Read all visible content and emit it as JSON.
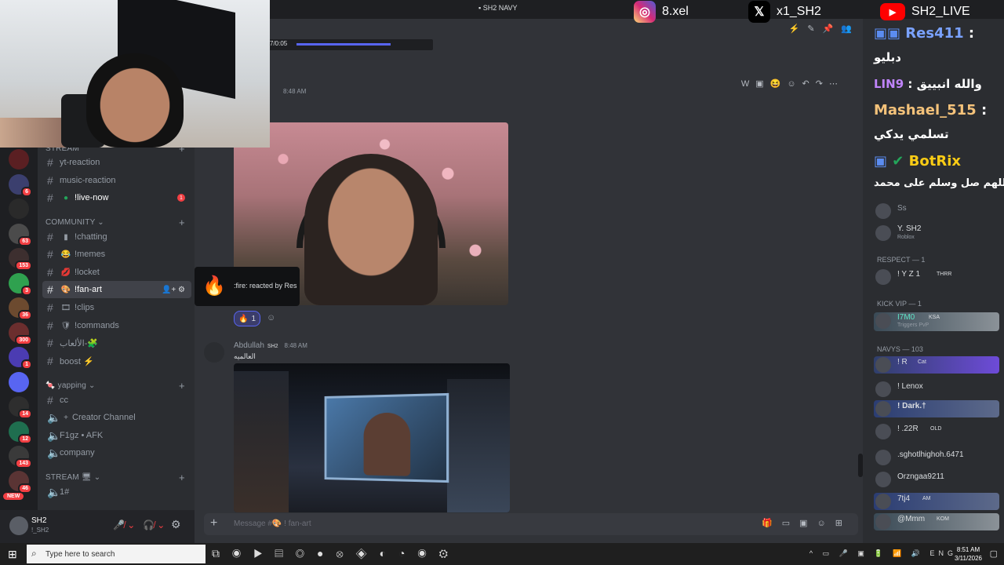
{
  "window": {
    "title": "SH2 NAVY"
  },
  "socials": [
    {
      "platform": "instagram",
      "handle": "8.xel",
      "color": "#d62976"
    },
    {
      "platform": "x",
      "handle": "x1_SH2",
      "color": "#000000"
    },
    {
      "platform": "youtube",
      "handle": "SH2_LIVE",
      "color": "#ff0000"
    }
  ],
  "video": {
    "time": "7/0:05"
  },
  "channels": {
    "categories": {
      "stream": "STREAM",
      "community": "COMMUNITY",
      "yapping": "yapping",
      "stream2": "STREAM"
    },
    "items": [
      {
        "name": "yt-reaction",
        "emoji": ""
      },
      {
        "name": "music-reaction",
        "emoji": ""
      },
      {
        "name": "live-now",
        "emoji": "●",
        "prefix": "!",
        "unread": "1"
      },
      {
        "name": "chatting",
        "emoji": "▮",
        "prefix": "!"
      },
      {
        "name": "memes",
        "emoji": "😂",
        "prefix": "!"
      },
      {
        "name": "locket",
        "emoji": "💋",
        "prefix": "!"
      },
      {
        "name": "fan-art",
        "emoji": "🎨",
        "prefix": "!",
        "active": true
      },
      {
        "name": "clips",
        "emoji": "🎞",
        "prefix": "!"
      },
      {
        "name": "commands",
        "emoji": "🛡",
        "prefix": "!"
      },
      {
        "name": "الألعاب-🧩",
        "emoji": ""
      },
      {
        "name": "boost ⚡",
        "emoji": ""
      },
      {
        "name": "cc",
        "emoji": ""
      },
      {
        "name": "Creator Channel",
        "emoji": "+"
      },
      {
        "name": "F1gz • AFK",
        "emoji": ""
      },
      {
        "name": "company",
        "emoji": ""
      },
      {
        "name": "1#",
        "emoji": ""
      }
    ]
  },
  "servers": [
    {
      "badge": "",
      "color": "#5a1f22"
    },
    {
      "badge": "6",
      "color": "#3b3f6e"
    },
    {
      "badge": "",
      "color": "#2a2a2a"
    },
    {
      "badge": "63",
      "color": "#4b4b4b"
    },
    {
      "badge": "153",
      "color": "#3d2f2f"
    },
    {
      "badge": "3",
      "color": "#2fa14f"
    },
    {
      "badge": "36",
      "color": "#6c4a2f"
    },
    {
      "badge": "300",
      "color": "#6b2e2e"
    },
    {
      "badge": "1",
      "color": "#4b3cb2"
    },
    {
      "badge": "",
      "color": "#5865f2"
    },
    {
      "badge": "14",
      "color": "#2e2e2e"
    },
    {
      "badge": "12",
      "color": "#1f6e4f"
    },
    {
      "badge": "143",
      "color": "#3a3a3a"
    },
    {
      "badge": "46",
      "color": "#5a3434"
    }
  ],
  "new_label": "NEW",
  "user": {
    "name": "SH2",
    "sub": "!_SH2"
  },
  "messages": {
    "first_time": "8:48 AM",
    "reaction_count": "1",
    "reaction_tooltip": ":fire: reacted by Res",
    "second": {
      "author": "Abdullah",
      "tag": "SH2",
      "time": "8:48 AM",
      "text": "العالميه"
    }
  },
  "composer": {
    "placeholder": "Message #🎨 ! fan-art"
  },
  "stream_chat": [
    {
      "user": "Res411",
      "text": "دبليو",
      "color": "#5b8cf0"
    },
    {
      "user": "LIN9",
      "text": "والله انبييق",
      "color": "#c084fc"
    },
    {
      "user": "Mashael_515",
      "text": "تسلمي يدكي",
      "color": "#f4c27a"
    },
    {
      "user": "BotRix",
      "text": "اللهم صل وسلم على محمد",
      "color": "#facc15"
    }
  ],
  "members": {
    "cats": {
      "respect": "RESPECT — 1",
      "kickvip": "KICK VIP — 1",
      "navys": "NAVYs — 103"
    },
    "top": [
      {
        "name": "Ss",
        "activity": ""
      },
      {
        "name": "Y.  SH2",
        "activity": "Roblox"
      }
    ],
    "respect": [
      {
        "name": "! Y Z 1",
        "tag": "THRR"
      }
    ],
    "kickvip": [
      {
        "name": "I7M0",
        "tag": "KSA",
        "activity": "Triggers PvP"
      }
    ],
    "navys": [
      {
        "name": "! R",
        "tag": "Cat"
      },
      {
        "name": "! Lenox",
        "tag": ""
      },
      {
        "name": "! Dark.†",
        "tag": ""
      },
      {
        "name": "! .22R",
        "tag": "OLD"
      },
      {
        "name": ".sghotlhighoh.6471",
        "tag": ""
      },
      {
        "name": "Orzngaa9211",
        "tag": ""
      },
      {
        "name": "7tj4",
        "tag": "AM"
      },
      {
        "name": "@Mmm",
        "tag": "KOM"
      }
    ]
  },
  "taskbar": {
    "search": "Type here to search",
    "lang": "ENG",
    "time": "8:51 AM",
    "date": "3/11/2026"
  }
}
